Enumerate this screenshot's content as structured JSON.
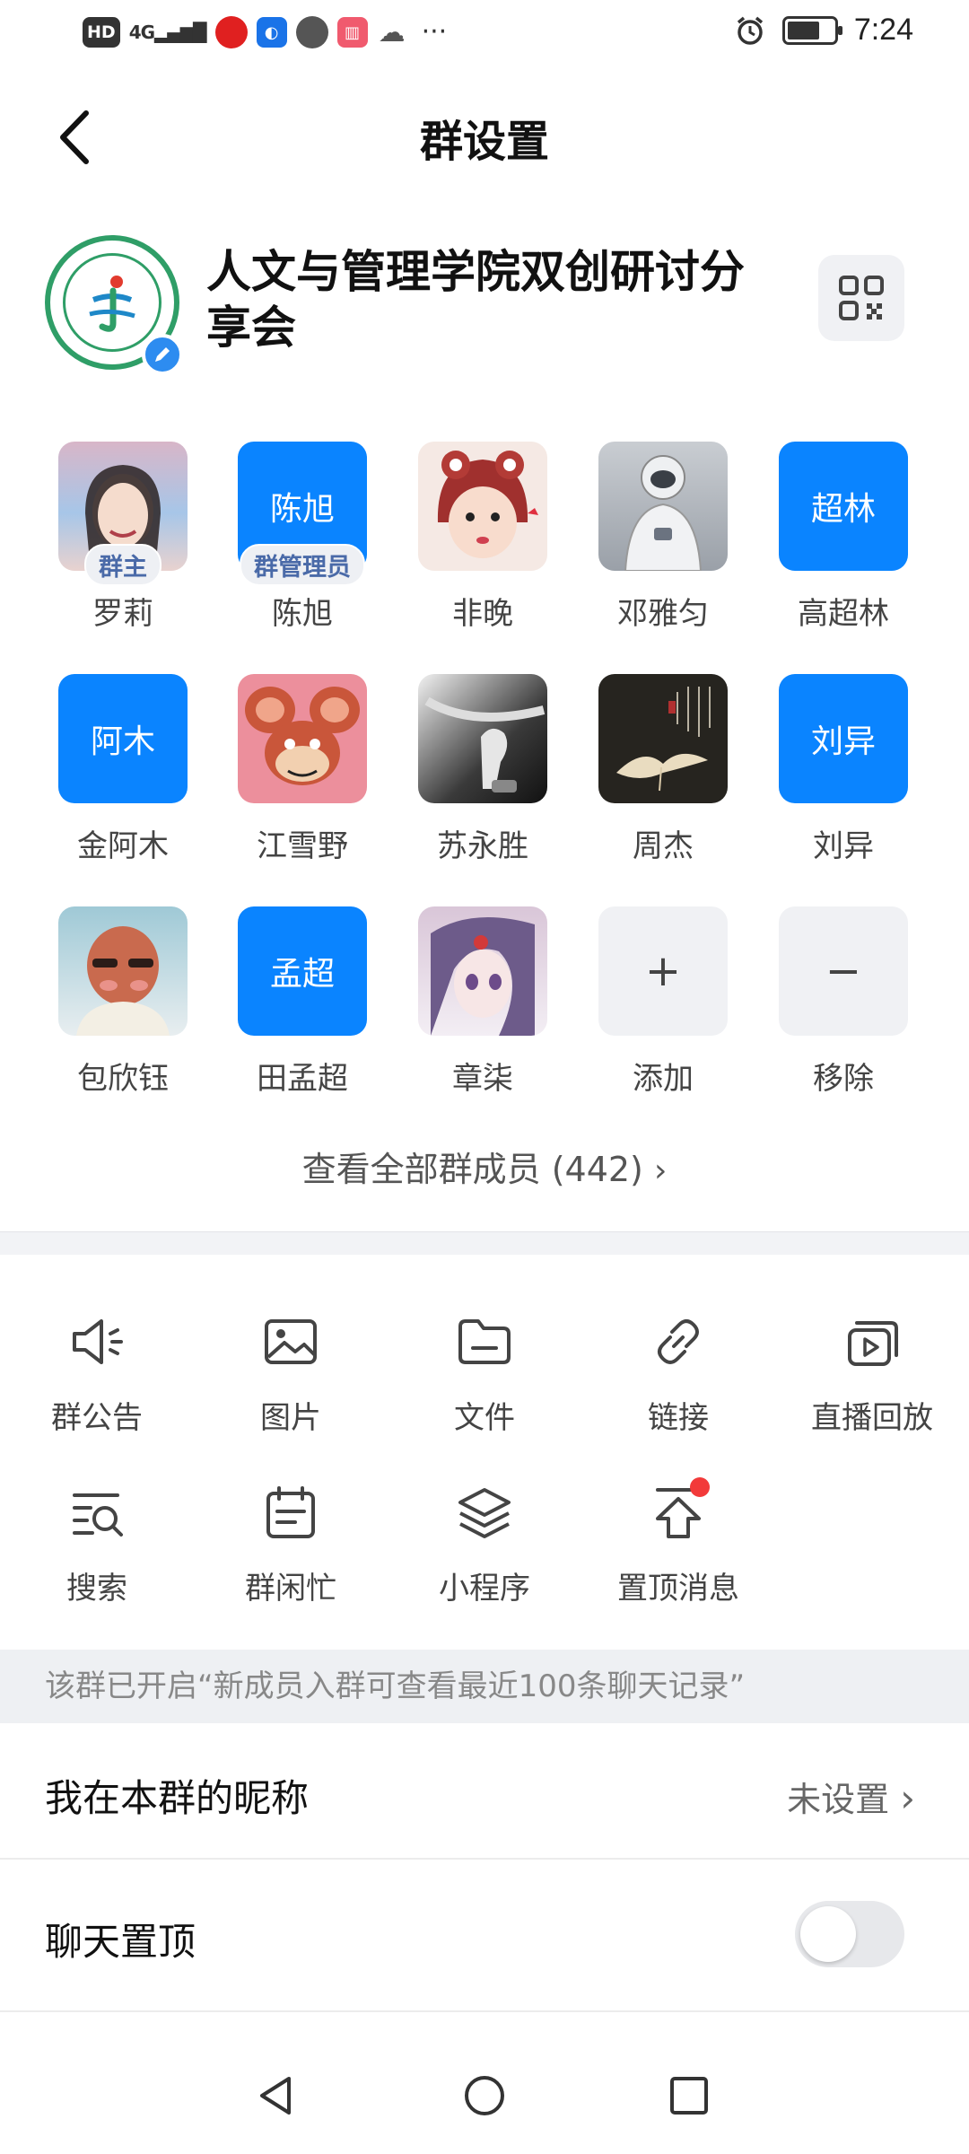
{
  "status_bar": {
    "time": "7:24",
    "hd_label": "HD",
    "network_label": "4G",
    "more": "···"
  },
  "header": {
    "title": "群设置"
  },
  "group": {
    "name": "人文与管理学院双创研讨分享会"
  },
  "members": [
    {
      "name": "罗莉",
      "badge": "群主"
    },
    {
      "name": "陈旭",
      "avatar_text": "陈旭",
      "badge": "群管理员"
    },
    {
      "name": "非晚"
    },
    {
      "name": "邓雅匀"
    },
    {
      "name": "高超林",
      "avatar_text": "超林"
    },
    {
      "name": "金阿木",
      "avatar_text": "阿木"
    },
    {
      "name": "江雪野"
    },
    {
      "name": "苏永胜"
    },
    {
      "name": "周杰"
    },
    {
      "name": "刘异",
      "avatar_text": "刘异"
    },
    {
      "name": "包欣钰"
    },
    {
      "name": "田孟超",
      "avatar_text": "孟超"
    },
    {
      "name": "章柒"
    }
  ],
  "member_actions": {
    "add_label": "添加",
    "add_symbol": "+",
    "remove_label": "移除",
    "remove_symbol": "−"
  },
  "view_all": "查看全部群成员 (442)",
  "tools": [
    {
      "label": "群公告",
      "icon": "megaphone-icon"
    },
    {
      "label": "图片",
      "icon": "image-icon"
    },
    {
      "label": "文件",
      "icon": "folder-icon"
    },
    {
      "label": "链接",
      "icon": "link-icon"
    },
    {
      "label": "直播回放",
      "icon": "replay-icon"
    },
    {
      "label": "搜索",
      "icon": "search-list-icon"
    },
    {
      "label": "群闲忙",
      "icon": "calendar-icon"
    },
    {
      "label": "小程序",
      "icon": "layers-icon"
    },
    {
      "label": "置顶消息",
      "icon": "pin-top-icon"
    }
  ],
  "notice": "该群已开启“新成员入群可查看最近100条聊天记录”",
  "settings": {
    "nickname_label": "我在本群的昵称",
    "nickname_value": "未设置",
    "pin_label": "聊天置顶",
    "pin_enabled": false
  },
  "colors": {
    "accent_blue": "#0a84ff",
    "notification_red": "#f23a3a",
    "group_logo_green": "#2f9e67"
  }
}
